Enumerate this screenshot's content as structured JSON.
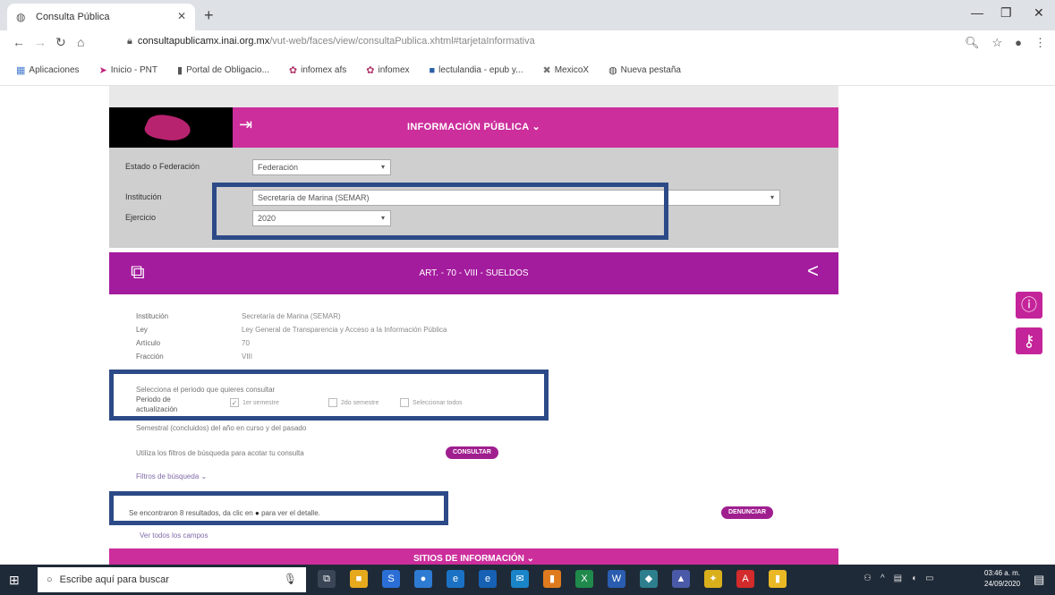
{
  "browser": {
    "tab_title": "Consulta Pública",
    "url_host": "consultapublicamx.inai.org.mx",
    "url_rest": "/vut-web/faces/view/consultaPublica.xhtml#tarjetaInformativa",
    "bookmarks": [
      {
        "icon": "apps-grid-icon",
        "label": "Aplicaciones"
      },
      {
        "icon": "pnt-logo-icon",
        "label": "Inicio - PNT"
      },
      {
        "icon": "document-icon",
        "label": "Portal de Obligacio..."
      },
      {
        "icon": "infomex-icon",
        "label": "infomex afs"
      },
      {
        "icon": "infomex-icon",
        "label": "infomex"
      },
      {
        "icon": "book-icon",
        "label": "lectulandia - epub y..."
      },
      {
        "icon": "mexico-icon",
        "label": "MexicoX"
      },
      {
        "icon": "globe-icon",
        "label": "Nueva pestaña"
      }
    ]
  },
  "header": {
    "title": "INFORMACIÓN PÚBLICA ⌄"
  },
  "filters": {
    "estado_label": "Estado o Federación",
    "estado_value": "Federación",
    "institucion_label": "Institución",
    "institucion_value": "Secretaría de Marina (SEMAR)",
    "ejercicio_label": "Ejercicio",
    "ejercicio_value": "2020"
  },
  "article": {
    "title": "ART. - 70 - VIII - SUELDOS"
  },
  "info": {
    "rows": [
      {
        "label": "Institución",
        "value": "Secretaría de Marina (SEMAR)"
      },
      {
        "label": "Ley",
        "value": "Ley General de Transparencia y Acceso a la Información Pública"
      },
      {
        "label": "Artículo",
        "value": "70"
      },
      {
        "label": "Fracción",
        "value": "VIII"
      }
    ]
  },
  "periodo": {
    "prompt": "Selecciona el periodo que quieres consultar",
    "label_line1": "Periodo de",
    "label_line2": "actualización",
    "options": [
      {
        "label": "1er semestre",
        "checked": true
      },
      {
        "label": "2do semestre",
        "checked": false
      },
      {
        "label": "Seleccionar todos",
        "checked": false
      }
    ],
    "note": "Semestral (concluidos) del año en curso y del pasado"
  },
  "search": {
    "hint": "Utiliza los filtros de búsqueda para acotar tu consulta",
    "consultar_label": "CONSULTAR",
    "filtros_label": "Filtros de búsqueda ⌄"
  },
  "results": {
    "text_before": "Se encontraron 8 resultados, da clic en",
    "text_after": "para ver el detalle.",
    "denunciar_label": "DENUNCIAR",
    "ver_todos": "Ver todos los campos"
  },
  "footer": {
    "title": "SITIOS DE INFORMACIÓN ⌄"
  },
  "taskbar": {
    "search_placeholder": "Escribe aquí para buscar",
    "time": "03:46 a. m.",
    "date": "24/09/2020"
  },
  "colors": {
    "magenta": "#cc2e9c",
    "purple": "#a41c9e",
    "highlight_border": "#2c4a87"
  }
}
